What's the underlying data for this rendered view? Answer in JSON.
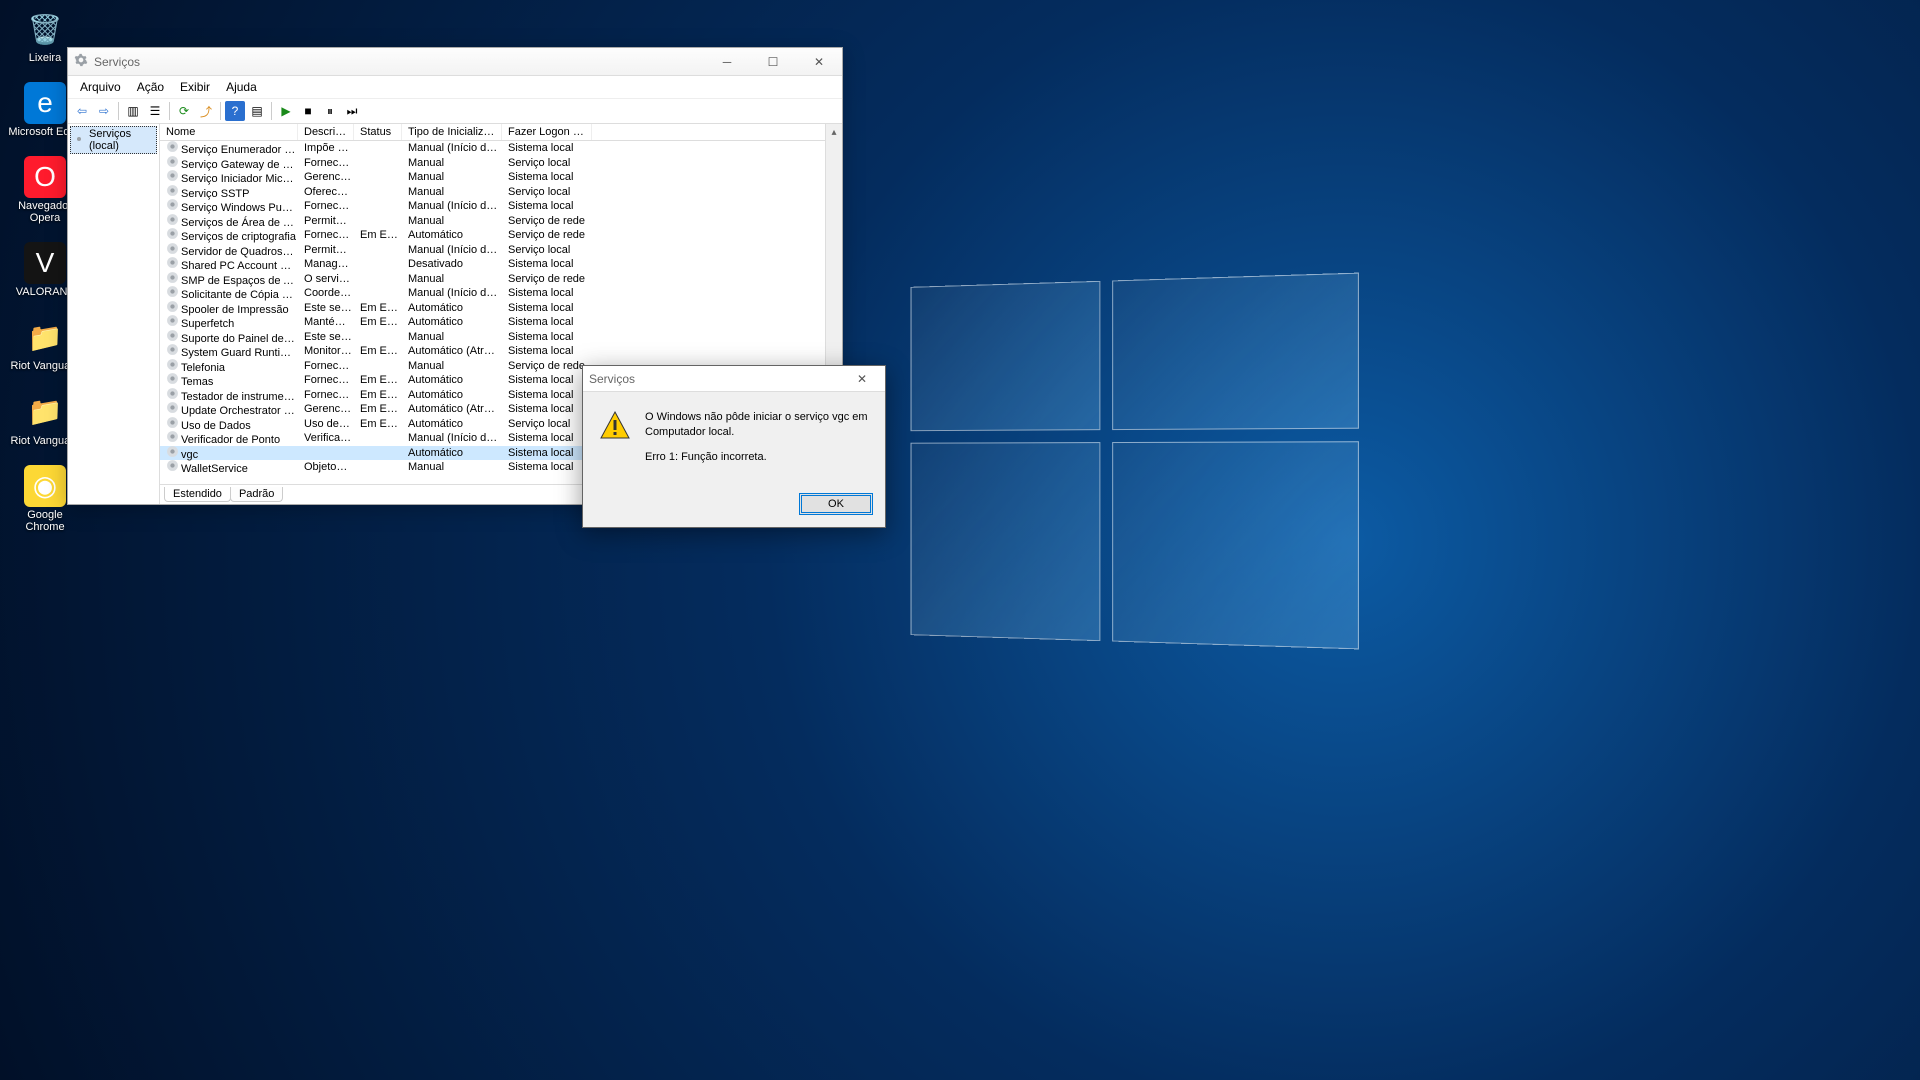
{
  "desktop": {
    "icons": [
      {
        "label": "Lixeira",
        "glyph": "🗑️"
      },
      {
        "label": "Microsoft Edge",
        "glyph": "e"
      },
      {
        "label": "Navegador Opera",
        "glyph": "O"
      },
      {
        "label": "VALORANT",
        "glyph": "V"
      },
      {
        "label": "Riot Vangua...",
        "glyph": "📁"
      },
      {
        "label": "Riot Vangua...",
        "glyph": "📁"
      },
      {
        "label": "Google Chrome",
        "glyph": "◉"
      }
    ]
  },
  "services_window": {
    "title": "Serviços",
    "menus": [
      "Arquivo",
      "Ação",
      "Exibir",
      "Ajuda"
    ],
    "tree_root": "Serviços (local)",
    "columns": [
      "Nome",
      "Descrição",
      "Status",
      "Tipo de Inicialização",
      "Fazer Logon como"
    ],
    "tabs": [
      "Estendido",
      "Padrão"
    ],
    "selected_row_name": "vgc",
    "rows": [
      {
        "name": "Serviço Enumerador de Dis...",
        "desc": "Impõe a p...",
        "status": "",
        "startup": "Manual (Início do Ga...",
        "logon": "Sistema local"
      },
      {
        "name": "Serviço Gateway de Camad...",
        "desc": "Fornece s...",
        "status": "",
        "startup": "Manual",
        "logon": "Serviço local"
      },
      {
        "name": "Serviço Iniciador Microsoft i...",
        "desc": "Gerencia a...",
        "status": "",
        "startup": "Manual",
        "logon": "Sistema local"
      },
      {
        "name": "Serviço SSTP",
        "desc": "Oferece s...",
        "status": "",
        "startup": "Manual",
        "logon": "Serviço local"
      },
      {
        "name": "Serviço Windows PushToIns...",
        "desc": "Fornece s...",
        "status": "",
        "startup": "Manual (Início do Ga...",
        "logon": "Sistema local"
      },
      {
        "name": "Serviços de Área de Trabalh...",
        "desc": "Permite q...",
        "status": "",
        "startup": "Manual",
        "logon": "Serviço de rede"
      },
      {
        "name": "Serviços de criptografia",
        "desc": "Fornece tr...",
        "status": "Em Exe...",
        "startup": "Automático",
        "logon": "Serviço de rede"
      },
      {
        "name": "Servidor de Quadros de Câ...",
        "desc": "Permite q...",
        "status": "",
        "startup": "Manual (Início do Ga...",
        "logon": "Serviço local"
      },
      {
        "name": "Shared PC Account Manager",
        "desc": "Manages ...",
        "status": "",
        "startup": "Desativado",
        "logon": "Sistema local"
      },
      {
        "name": "SMP de Espaços de Armaze...",
        "desc": "O serviço ...",
        "status": "",
        "startup": "Manual",
        "logon": "Serviço de rede"
      },
      {
        "name": "Solicitante de Cópia de So...",
        "desc": "Coordena ...",
        "status": "",
        "startup": "Manual (Início do Ga...",
        "logon": "Sistema local"
      },
      {
        "name": "Spooler de Impressão",
        "desc": "Este serviç...",
        "status": "Em Exe...",
        "startup": "Automático",
        "logon": "Sistema local"
      },
      {
        "name": "Superfetch",
        "desc": "Mantém e...",
        "status": "Em Exe...",
        "startup": "Automático",
        "logon": "Sistema local"
      },
      {
        "name": "Suporte do Painel de Contr...",
        "desc": "Este serviç...",
        "status": "",
        "startup": "Manual",
        "logon": "Sistema local"
      },
      {
        "name": "System Guard Runtime Mo...",
        "desc": "Monitora e...",
        "status": "Em Exe...",
        "startup": "Automático (Atraso ...",
        "logon": "Sistema local"
      },
      {
        "name": "Telefonia",
        "desc": "Fornece s...",
        "status": "",
        "startup": "Manual",
        "logon": "Serviço de rede"
      },
      {
        "name": "Temas",
        "desc": "Fornece g...",
        "status": "Em Exe...",
        "startup": "Automático",
        "logon": "Sistema local"
      },
      {
        "name": "Testador de instrumentação...",
        "desc": "Fornece u...",
        "status": "Em Exe...",
        "startup": "Automático",
        "logon": "Sistema local"
      },
      {
        "name": "Update Orchestrator Service",
        "desc": "Gerencia ...",
        "status": "Em Exe...",
        "startup": "Automático (Atraso ...",
        "logon": "Sistema local"
      },
      {
        "name": "Uso de Dados",
        "desc": "Uso de da...",
        "status": "Em Exe...",
        "startup": "Automático",
        "logon": "Serviço local"
      },
      {
        "name": "Verificador de Ponto",
        "desc": "Verifica po...",
        "status": "",
        "startup": "Manual (Início do Ga...",
        "logon": "Sistema local"
      },
      {
        "name": "vgc",
        "desc": "",
        "status": "",
        "startup": "Automático",
        "logon": "Sistema local"
      },
      {
        "name": "WalletService",
        "desc": "Objetos d...",
        "status": "",
        "startup": "Manual",
        "logon": "Sistema local"
      }
    ]
  },
  "dialog": {
    "title": "Serviços",
    "line1": "O Windows não pôde iniciar o serviço vgc em Computador local.",
    "line2": "Erro 1: Função incorreta.",
    "ok_label": "OK"
  }
}
